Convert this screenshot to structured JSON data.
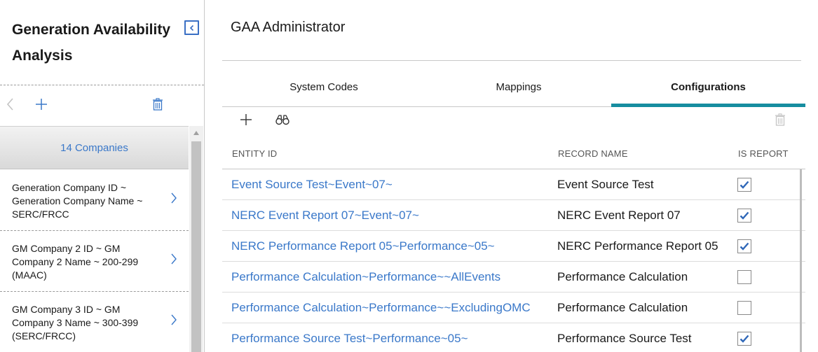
{
  "left_panel": {
    "title": "Generation Availability Analysis",
    "list_header": "14 Companies",
    "items": [
      {
        "label": "Generation Company ID ~ Generation Company Name ~ SERC/FRCC"
      },
      {
        "label": "GM Company 2 ID ~ GM Company 2 Name ~ 200-299 (MAAC)"
      },
      {
        "label": "GM Company 3 ID ~ GM Company 3 Name ~ 300-399 (SERC/FRCC)"
      }
    ],
    "icons": {
      "collapse": "collapse-left-icon",
      "back": "chevron-left-icon",
      "add": "plus-icon",
      "delete": "trash-icon"
    }
  },
  "main": {
    "title": "GAA Administrator",
    "tabs": [
      {
        "label": "System Codes",
        "active": false
      },
      {
        "label": "Mappings",
        "active": false
      },
      {
        "label": "Configurations",
        "active": true
      }
    ],
    "toolbar": {
      "add_icon": "plus-icon",
      "search_icon": "binoculars-icon",
      "delete_icon": "trash-icon"
    },
    "table": {
      "columns": [
        "ENTITY ID",
        "RECORD NAME",
        "IS REPORT"
      ],
      "rows": [
        {
          "entity_id": "Event Source Test~Event~07~",
          "record_name": "Event Source Test",
          "is_report": true
        },
        {
          "entity_id": "NERC Event Report 07~Event~07~",
          "record_name": "NERC Event Report 07",
          "is_report": true
        },
        {
          "entity_id": "NERC Performance Report 05~Performance~05~",
          "record_name": "NERC Performance Report 05",
          "is_report": true
        },
        {
          "entity_id": "Performance Calculation~Performance~~AllEvents",
          "record_name": "Performance Calculation",
          "is_report": false
        },
        {
          "entity_id": "Performance Calculation~Performance~~ExcludingOMC",
          "record_name": "Performance Calculation",
          "is_report": false
        },
        {
          "entity_id": "Performance Source Test~Performance~05~",
          "record_name": "Performance Source Test",
          "is_report": true
        }
      ]
    }
  },
  "colors": {
    "link": "#3a78c9",
    "tab_indicator": "#168da0",
    "checkmark": "#2f67b8"
  }
}
